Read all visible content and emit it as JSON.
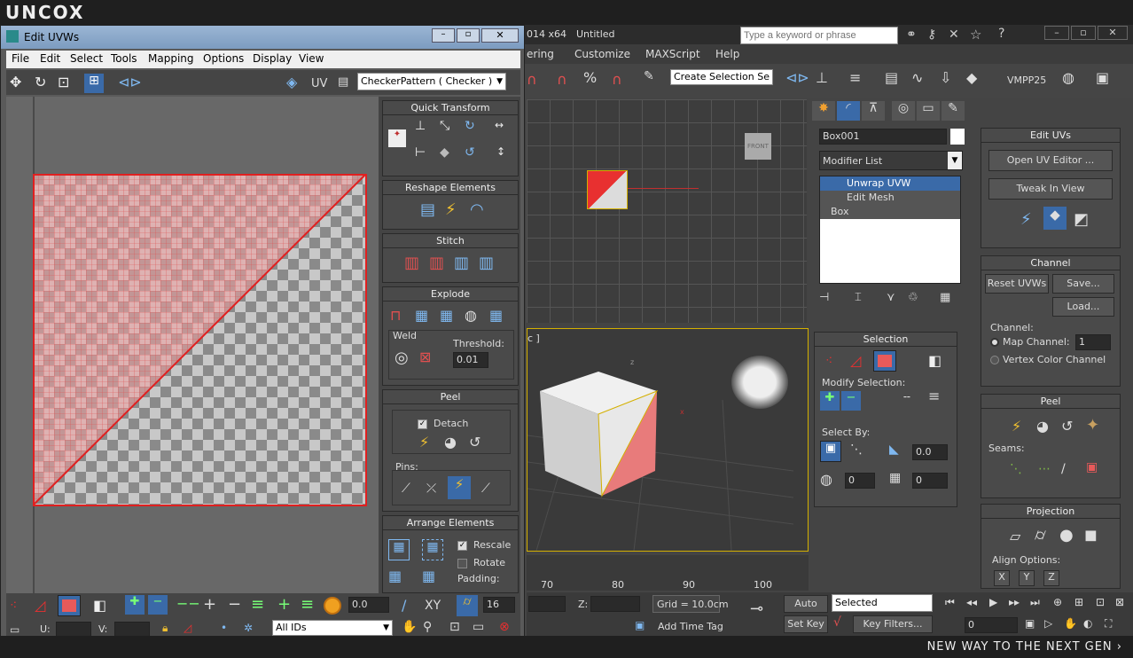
{
  "brand": {
    "logo": "UNCOX",
    "tagline": "NEW WAY TO THE NEXT GEN ›"
  },
  "max": {
    "title_version": "014 x64",
    "title_file": "Untitled",
    "search_placeholder": "Type a keyword or phrase",
    "menu": [
      "ering",
      "Customize",
      "MAXScript",
      "Help"
    ],
    "selection_set": "Create Selection Se",
    "vmpp": "VMPP25",
    "object_name": "Box001",
    "modifier_list": "Modifier List",
    "stack": [
      "Unwrap UVW",
      "Edit Mesh",
      "Box"
    ],
    "viewport_label": "c ]",
    "ruler": [
      "70",
      "80",
      "90",
      "100"
    ],
    "status": {
      "z_label": "Z:",
      "grid": "Grid = 10.0cm",
      "auto_key": "Auto Key",
      "selected": "Selected",
      "set_key": "Set Key",
      "key_filters": "Key Filters...",
      "add_time_tag": "Add Time Tag",
      "frame": "0"
    }
  },
  "selection_panel": {
    "title": "Selection",
    "modify_selection": "Modify Selection:",
    "select_by": "Select By:",
    "val1": "0.0",
    "val2": "0",
    "val3": "0"
  },
  "right_panel": {
    "edit_uvs": "Edit UVs",
    "open_uv_editor": "Open UV Editor ...",
    "tweak_in_view": "Tweak In View",
    "channel": "Channel",
    "reset_uvws": "Reset UVWs",
    "save": "Save...",
    "load": "Load...",
    "channel_label": "Channel:",
    "map_channel": "Map Channel:",
    "map_channel_value": "1",
    "vertex_color_channel": "Vertex Color Channel",
    "peel": "Peel",
    "seams": "Seams:",
    "projection": "Projection",
    "align_options": "Align Options:",
    "align_axes": [
      "X",
      "Y",
      "Z"
    ]
  },
  "uvw": {
    "title": "Edit UVWs",
    "menu": [
      "File",
      "Edit",
      "Select",
      "Tools",
      "Mapping",
      "Options",
      "Display",
      "View"
    ],
    "uv_label": "UV",
    "pattern": "CheckerPattern  ( Checker )",
    "quick_transform": "Quick Transform",
    "reshape_elements": "Reshape Elements",
    "stitch": "Stitch",
    "explode": "Explode",
    "weld": "Weld",
    "threshold": "Threshold:",
    "threshold_value": "0.01",
    "peel": "Peel",
    "detach": "Detach",
    "pins": "Pins:",
    "arrange_elements": "Arrange Elements",
    "rescale": "Rescale",
    "rotate": "Rotate",
    "padding": "Padding:",
    "bottom": {
      "value1": "0.0",
      "xy": "XY",
      "value2": "16",
      "u": "U:",
      "v": "V:",
      "ids": "All IDs"
    }
  },
  "colors": {
    "accent_red": "#e83030",
    "uv_blue": "#2c6fd8",
    "selection_yellow": "#d4b000"
  }
}
